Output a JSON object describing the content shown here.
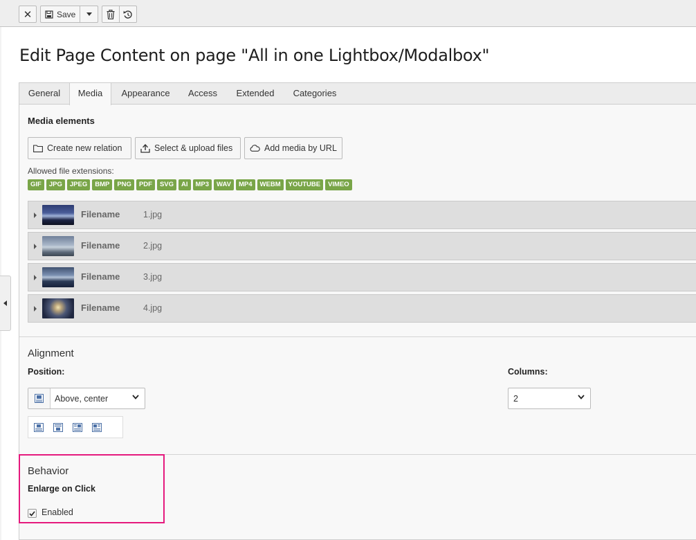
{
  "toolbar": {
    "close_icon": "close-icon",
    "save_label": "Save",
    "delete_icon": "trash-icon",
    "undo_icon": "undo-icon"
  },
  "page": {
    "title": "Edit Page Content on page \"All in one Lightbox/Modalbox\""
  },
  "tabs": [
    {
      "label": "General"
    },
    {
      "label": "Media",
      "active": true
    },
    {
      "label": "Appearance"
    },
    {
      "label": "Access"
    },
    {
      "label": "Extended"
    },
    {
      "label": "Categories"
    }
  ],
  "media": {
    "section_title": "Media elements",
    "buttons": {
      "create_relation": "Create new relation",
      "select_upload": "Select & upload files",
      "add_url": "Add media by URL"
    },
    "allowed_label": "Allowed file extensions:",
    "extensions": [
      "GIF",
      "JPG",
      "JPEG",
      "BMP",
      "PNG",
      "PDF",
      "SVG",
      "AI",
      "MP3",
      "WAV",
      "MP4",
      "WEBM",
      "YOUTUBE",
      "VIMEO"
    ],
    "extension_color": "#79a548",
    "files": [
      {
        "label": "Filename",
        "value": "1.jpg"
      },
      {
        "label": "Filename",
        "value": "2.jpg"
      },
      {
        "label": "Filename",
        "value": "3.jpg"
      },
      {
        "label": "Filename",
        "value": "4.jpg"
      }
    ]
  },
  "alignment": {
    "title": "Alignment",
    "position_label": "Position:",
    "position_value": "Above, center",
    "columns_label": "Columns:",
    "columns_value": "2"
  },
  "behavior": {
    "title": "Behavior",
    "enlarge_label": "Enlarge on Click",
    "enabled_label": "Enabled",
    "enabled_checked": true,
    "highlight_color": "#e5197d"
  }
}
